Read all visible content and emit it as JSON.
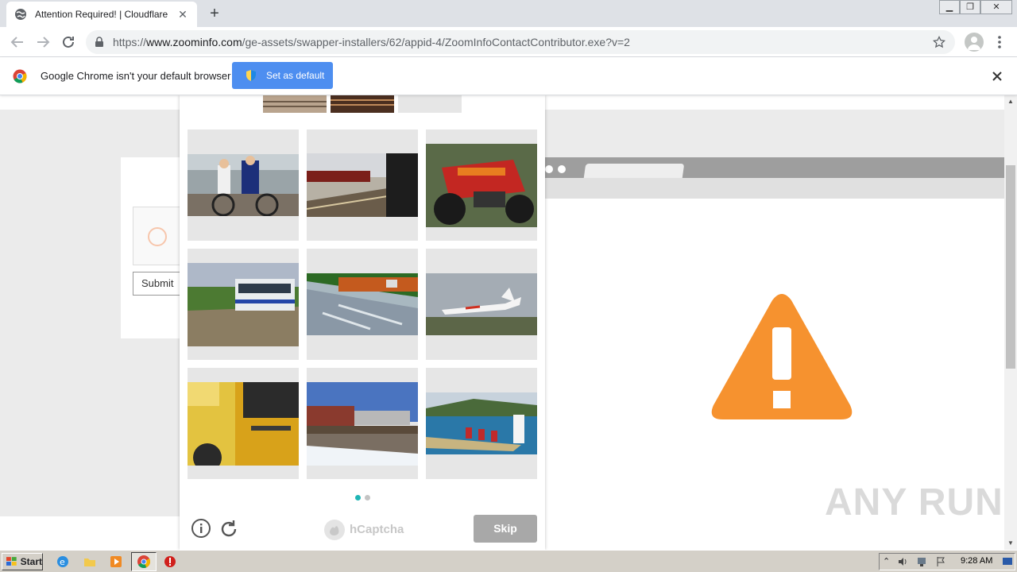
{
  "browser": {
    "tab_title": "Attention Required! | Cloudflare",
    "tab_close": "✕",
    "new_tab": "+",
    "url_scheme": "https://",
    "url_host": "www.zoominfo.com",
    "url_path": "/ge-assets/swapper-installers/62/appid-4/ZoomInfoContactContributor.exe?v=2"
  },
  "infobar": {
    "message": "Google Chrome isn't your default browser",
    "button_label": "Set as default"
  },
  "cloudflare": {
    "submit_label": "Submit"
  },
  "captcha": {
    "brand": "hCaptcha",
    "skip_label": "Skip",
    "page_count": 2,
    "current_page": 1
  },
  "watermark": "ANY RUN",
  "taskbar": {
    "start_label": "Start",
    "clock": "9:28 AM"
  },
  "colors": {
    "accent_blue": "#4d8ef0",
    "warning_orange": "#f6922f",
    "captcha_teal": "#1fb5b5"
  },
  "icons": [
    "globe-icon",
    "lock-icon",
    "star-icon",
    "profile-icon",
    "menu-icon",
    "chrome-icon",
    "shield-icon",
    "close-icon",
    "warning-icon",
    "info-icon",
    "refresh-icon",
    "hcaptcha-logo-icon"
  ]
}
